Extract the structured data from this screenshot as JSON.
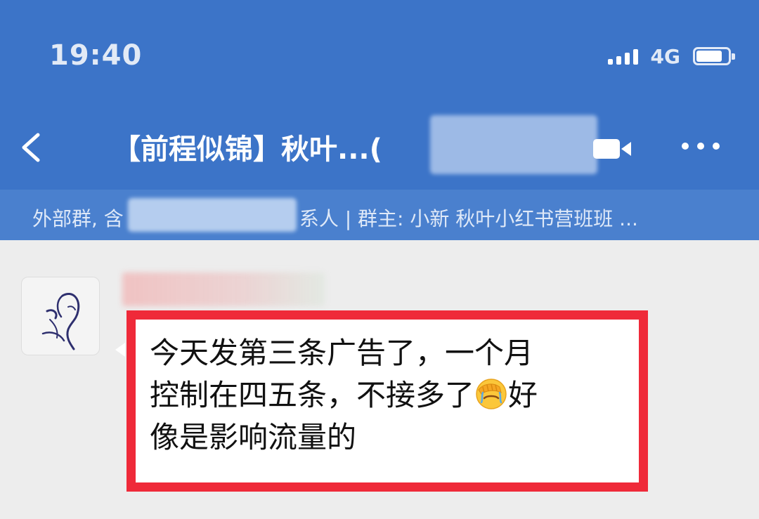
{
  "status_bar": {
    "time": "19:40",
    "network": "4G",
    "battery": "81"
  },
  "nav": {
    "title": "【前程似锦】秋叶...("
  },
  "info_bar": {
    "prefix": "外部群, 含",
    "suffix": "系人 | 群主: 小新 秋叶小红书营班班 ..."
  },
  "message": {
    "line1": "今天发第三条广告了，一个月",
    "line2a": "控制在四五条，不接多了",
    "emoji": "facepalm-emoji",
    "line2b": "好",
    "line3": "像是影响流量的"
  },
  "colors": {
    "header_blue": "#3c74c8",
    "info_blue": "#4a80ce",
    "highlight_red": "#ef2a39",
    "background": "#ededed"
  }
}
